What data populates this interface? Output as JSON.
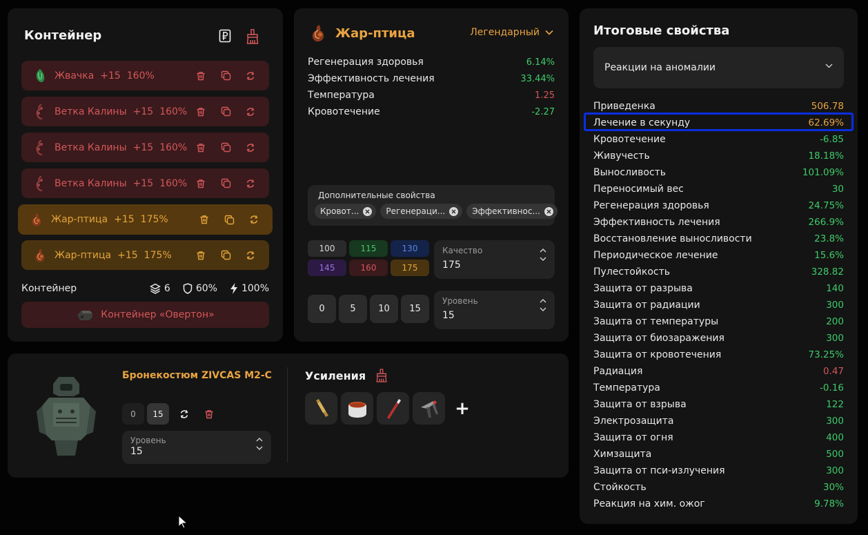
{
  "container_panel": {
    "title": "Контейнер",
    "slots": [
      {
        "name": "Жвачка",
        "level": "+15",
        "pct": "160%",
        "tier": "red",
        "art": "green"
      },
      {
        "name": "Ветка Калины",
        "level": "+15",
        "pct": "160%",
        "tier": "red",
        "art": "branch"
      },
      {
        "name": "Ветка Калины",
        "level": "+15",
        "pct": "160%",
        "tier": "red",
        "art": "branch"
      },
      {
        "name": "Ветка Калины",
        "level": "+15",
        "pct": "160%",
        "tier": "red",
        "art": "branch"
      },
      {
        "name": "Жар-птица",
        "level": "+15",
        "pct": "175%",
        "tier": "gold",
        "art": "firebird"
      },
      {
        "name": "Жар-птица",
        "level": "+15",
        "pct": "175%",
        "tier": "gold",
        "art": "firebird"
      }
    ],
    "footer_label": "Контейнер",
    "slots_count": "6",
    "protection": "60%",
    "efficiency": "100%",
    "container_name": "Контейнер «Овертон»"
  },
  "artifact_panel": {
    "name": "Жар-птица",
    "rarity": "Легендарный",
    "props": [
      {
        "label": "Регенерация здоровья",
        "value": "6.14%",
        "color": "#3ecb6a"
      },
      {
        "label": "Эффективность лечения",
        "value": "33.44%",
        "color": "#3ecb6a"
      },
      {
        "label": "Температура",
        "value": "1.25",
        "color": "#d3575b"
      },
      {
        "label": "Кровотечение",
        "value": "-2.27",
        "color": "#3ecb6a"
      }
    ],
    "extra_label": "Дополнительные свойства",
    "chips": [
      "Кровот...",
      "Регенераци...",
      "Эффективнос..."
    ],
    "quality_options": [
      {
        "v": "100",
        "bg": "#2a2a2a",
        "fg": "#d8d8d8"
      },
      {
        "v": "115",
        "bg": "#16391f",
        "fg": "#49c46c"
      },
      {
        "v": "130",
        "bg": "#14234a",
        "fg": "#5b84e6"
      },
      {
        "v": "145",
        "bg": "#2c1a44",
        "fg": "#9a73da"
      },
      {
        "v": "160",
        "bg": "#3a1a1c",
        "fg": "#d3575b"
      },
      {
        "v": "175",
        "bg": "#4a3410",
        "fg": "#e5a53a"
      }
    ],
    "quality_label": "Качество",
    "quality_value": "175",
    "level_buttons": [
      "0",
      "5",
      "10",
      "15"
    ],
    "level_label": "Уровень",
    "level_value": "15"
  },
  "armor_panel": {
    "name": "Бронекостюм ZIVCAS M2-C",
    "btn_min": "0",
    "btn_max": "15",
    "level_label": "Уровень",
    "level_value": "15",
    "boosts_title": "Усиления",
    "plus": "+"
  },
  "summary_panel": {
    "title": "Итоговые свойства",
    "select": "Реакции на аномалии",
    "rows": [
      {
        "label": "Приведенка",
        "value": "506.78",
        "color": "#e9a441"
      },
      {
        "label": "Лечение в секунду",
        "value": "62.69%",
        "color": "#e9a441"
      },
      {
        "label": "Кровотечение",
        "value": "-6.85",
        "color": "#3ecb6a"
      },
      {
        "label": "Живучесть",
        "value": "18.18%",
        "color": "#3ecb6a"
      },
      {
        "label": "Выносливость",
        "value": "101.09%",
        "color": "#3ecb6a"
      },
      {
        "label": "Переносимый вес",
        "value": "30",
        "color": "#3ecb6a"
      },
      {
        "label": "Регенерация здоровья",
        "value": "24.75%",
        "color": "#3ecb6a"
      },
      {
        "label": "Эффективность лечения",
        "value": "266.9%",
        "color": "#3ecb6a"
      },
      {
        "label": "Восстановление выносливости",
        "value": "23.8%",
        "color": "#3ecb6a"
      },
      {
        "label": "Периодическое лечение",
        "value": "15.6%",
        "color": "#3ecb6a"
      },
      {
        "label": "Пулестойкость",
        "value": "328.82",
        "color": "#3ecb6a"
      },
      {
        "label": "Защита от разрыва",
        "value": "140",
        "color": "#3ecb6a"
      },
      {
        "label": "Защита от радиации",
        "value": "300",
        "color": "#3ecb6a"
      },
      {
        "label": "Защита от температуры",
        "value": "200",
        "color": "#3ecb6a"
      },
      {
        "label": "Защита от биозаражения",
        "value": "300",
        "color": "#3ecb6a"
      },
      {
        "label": "Защита от кровотечения",
        "value": "73.25%",
        "color": "#3ecb6a"
      },
      {
        "label": "Радиация",
        "value": "0.47",
        "color": "#d3575b"
      },
      {
        "label": "Температура",
        "value": "-0.16",
        "color": "#3ecb6a"
      },
      {
        "label": "Защита от взрыва",
        "value": "122",
        "color": "#3ecb6a"
      },
      {
        "label": "Электрозащита",
        "value": "300",
        "color": "#3ecb6a"
      },
      {
        "label": "Защита от огня",
        "value": "400",
        "color": "#3ecb6a"
      },
      {
        "label": "Химзащита",
        "value": "500",
        "color": "#3ecb6a"
      },
      {
        "label": "Защита от пси-излучения",
        "value": "300",
        "color": "#3ecb6a"
      },
      {
        "label": "Стойкость",
        "value": "30%",
        "color": "#3ecb6a"
      },
      {
        "label": "Реакция на хим. ожог",
        "value": "9.78%",
        "color": "#3ecb6a"
      }
    ]
  }
}
